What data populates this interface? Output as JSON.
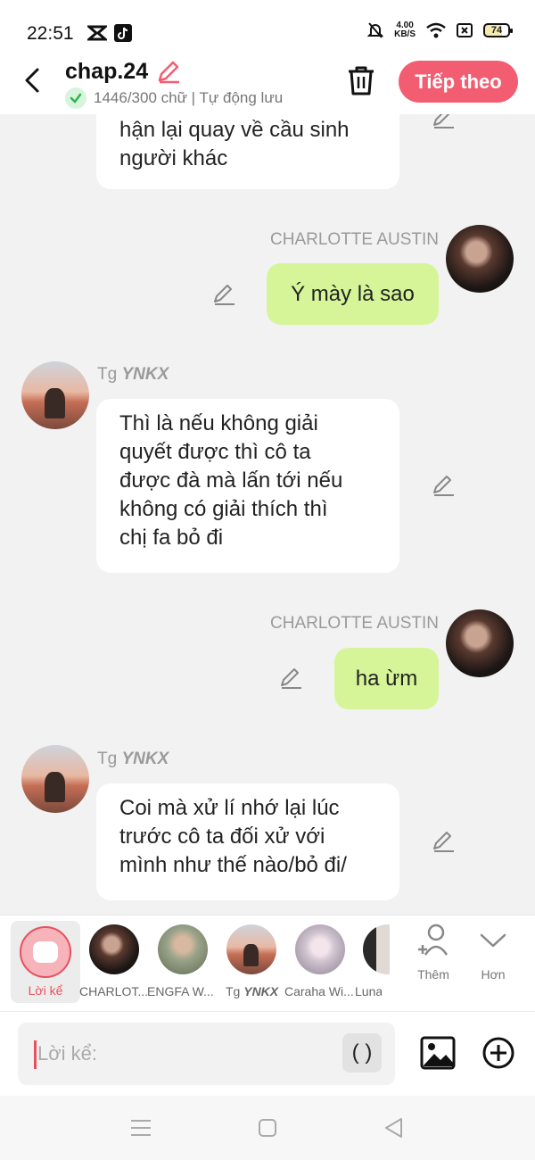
{
  "status": {
    "time": "22:51",
    "speed_value": "4.00",
    "speed_unit": "KB/S",
    "battery": "74"
  },
  "header": {
    "title": "chap.24",
    "subtitle": "1446/300 chữ | Tự động lưu",
    "next_label": "Tiếp theo"
  },
  "messages": [
    {
      "side": "left",
      "text_lines": [
        "hận lại quay về cầu sinh",
        "người khác"
      ]
    },
    {
      "side": "right",
      "name": "CHARLOTTE AUSTIN",
      "text": "Ý mày là sao"
    },
    {
      "side": "left",
      "name_prefix": "Tg",
      "name_em": "YNKX",
      "text_lines": [
        "Thì là nếu không giải",
        "quyết được thì cô ta",
        "được đà mà lấn tới nếu",
        "không có giải thích thì",
        "chị fa bỏ đi"
      ]
    },
    {
      "side": "right",
      "name": "CHARLOTTE AUSTIN",
      "text": "ha ừm"
    },
    {
      "side": "left",
      "name_prefix": "Tg",
      "name_em": "YNKX",
      "text_lines": [
        "Coi mà xử lí nhớ lại lúc",
        "trước cô ta đối xử với",
        "mình như thế nào/bỏ đi/"
      ]
    }
  ],
  "character_bar": {
    "narrator_label": "Lời kể",
    "characters": [
      {
        "name": "CHARLOT..."
      },
      {
        "name": "ENGFA W..."
      },
      {
        "name_prefix": "Tg",
        "name_em": "YNKX"
      },
      {
        "name": "Caraha Wi..."
      },
      {
        "name": "Luna"
      }
    ],
    "more_label": "Thêm",
    "other_label": "Hơn"
  },
  "input": {
    "placeholder": "Lời kể:",
    "paren_label": "( )"
  },
  "colors": {
    "accent": "#f25d72",
    "my_bubble": "#d6f598",
    "their_bubble": "#ffffff",
    "background": "#f2f2f2"
  }
}
